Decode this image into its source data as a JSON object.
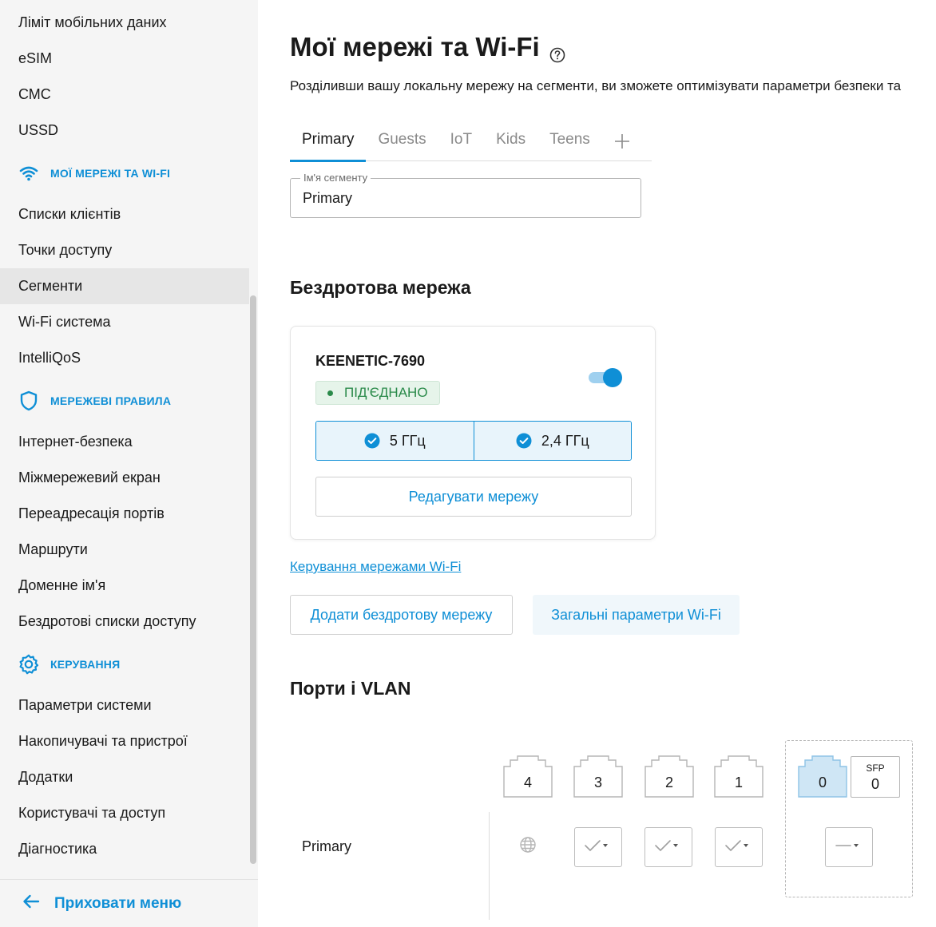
{
  "sidebar": {
    "items_top": [
      "Ліміт мобільних даних",
      "eSIM",
      "СМС",
      "USSD"
    ],
    "group_networks": "МОЇ МЕРЕЖІ ТА WI-FI",
    "items_networks": [
      "Списки клієнтів",
      "Точки доступу",
      "Сегменти",
      "Wi-Fi система",
      "IntelliQoS"
    ],
    "active_item": "Сегменти",
    "group_rules": "МЕРЕЖЕВІ ПРАВИЛА",
    "items_rules": [
      "Інтернет-безпека",
      "Міжмережевий екран",
      "Переадресація портів",
      "Маршрути",
      "Доменне ім'я",
      "Бездротові списки доступу"
    ],
    "group_manage": "КЕРУВАННЯ",
    "items_manage": [
      "Параметри системи",
      "Накопичувачі та пристрої",
      "Додатки",
      "Користувачі та доступ",
      "Діагностика"
    ],
    "hide_menu": "Приховати меню",
    "accent_color": "#0f8fd6"
  },
  "main": {
    "title": "Мої мережі та Wi-Fi",
    "description": "Розділивши вашу локальну мережу на сегменти, ви зможете оптимізувати параметри безпеки та",
    "tabs": [
      "Primary",
      "Guests",
      "IoT",
      "Kids",
      "Teens"
    ],
    "active_tab": "Primary",
    "segment_name": {
      "label": "Ім'я сегменту",
      "value": "Primary"
    },
    "wireless": {
      "title": "Бездротова мережа",
      "ssid": "KEENETIC-7690",
      "status": "ПІД'ЄДНАНО",
      "enabled": true,
      "bands": [
        "5 ГГц",
        "2,4 ГГц"
      ],
      "edit_button": "Редагувати мережу",
      "manage_link": "Керування мережами Wi-Fi",
      "add_button": "Додати бездротову мережу",
      "general_button": "Загальні параметри Wi-Fi"
    },
    "ports": {
      "title": "Порти і VLAN",
      "lan_ports": [
        "4",
        "3",
        "2",
        "1"
      ],
      "wan_port": "0",
      "sfp_label": "SFP",
      "sfp_port": "0",
      "row_label": "Primary"
    }
  }
}
